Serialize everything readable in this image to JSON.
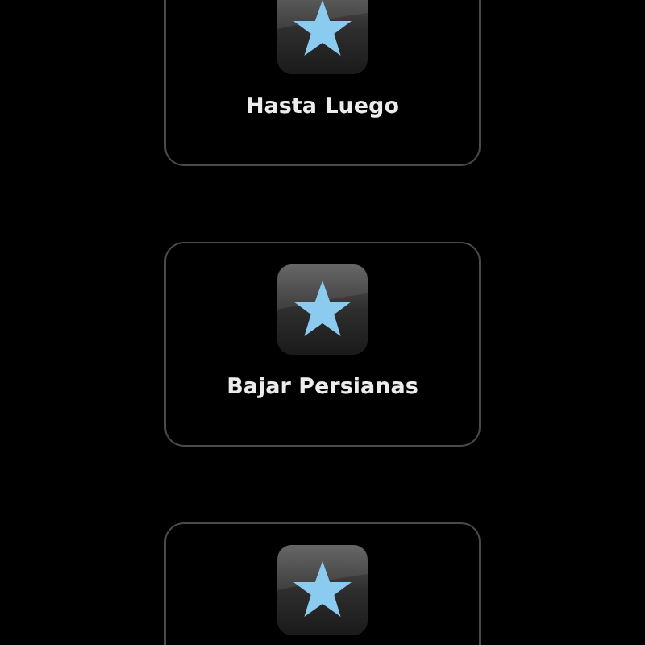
{
  "shortcuts": [
    {
      "kind": "shortcut",
      "label": "Hasta Luego"
    },
    {
      "kind": "shortcut",
      "label": "Bajar Persianas"
    },
    {
      "kind": "shortcut"
    }
  ]
}
